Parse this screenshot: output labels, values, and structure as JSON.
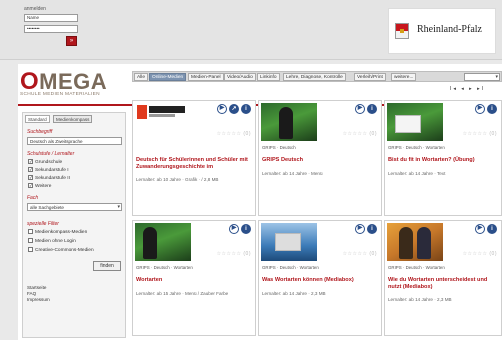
{
  "login": {
    "title": "anmelden",
    "username": "Name",
    "password": "••••••••",
    "submit": "»"
  },
  "brand": {
    "partner": "Rheinland-Pfalz",
    "logo_main": "MEGA",
    "logo_first": "O",
    "logo_sub": "SCHULE MEDIEN MATERIALIEN"
  },
  "tabs": [
    {
      "label": "Alle",
      "active": false
    },
    {
      "label": "Online-Medien",
      "active": true
    },
    {
      "label": "Medien-Panel",
      "active": false
    },
    {
      "label": "Video/Audio",
      "active": false
    },
    {
      "label": "Linkinfo",
      "active": false
    },
    {
      "label": "Lehre, Diagnose, Kontrolle",
      "active": false
    },
    {
      "label": "Verleih/Print",
      "active": false
    }
  ],
  "tab_more": "weitere...",
  "pager": "I◂ ◂ ▸ ▸I",
  "sidebar": {
    "tabs": [
      "Standard",
      "Medienkompass"
    ],
    "search_label": "Suchbegriff",
    "search_value": "Deutsch als Zweitsprache",
    "schools_label": "Schulstufe / Lernalter",
    "schools": [
      {
        "label": "Grundschule",
        "checked": true
      },
      {
        "label": "Sekundarstufe I",
        "checked": true
      },
      {
        "label": "Sekundarstufe II",
        "checked": true
      },
      {
        "label": "Weitere",
        "checked": true
      }
    ],
    "subject_label": "Fach",
    "subject_value": "alle Sachgebiete",
    "filter_label": "spezielle Filter",
    "filters": [
      {
        "label": "Medienkompass-Medien",
        "checked": false
      },
      {
        "label": "Medien ohne Login",
        "checked": false
      },
      {
        "label": "Creative-Commons-Medien",
        "checked": false
      }
    ],
    "find_button": "finden",
    "footer_links": [
      "Startseite",
      "FAQ",
      "Impressum"
    ]
  },
  "cards": [
    {
      "thumb": "white",
      "meta": "",
      "title": "Deutsch für Schülerinnen und Schüler mit Zuwanderungsgeschichte im",
      "info": "Lernalter: ab 10 Jahre · Grafik · / 2,8 MB"
    },
    {
      "thumb": "green",
      "meta": "GRIPS · Deutsch",
      "title": "GRIPS Deutsch",
      "info": "Lernalter: ab 14 Jahre · Menü"
    },
    {
      "thumb": "green",
      "meta": "GRIPS · Deutsch · Wortarten",
      "title": "Bist du fit in Wortarten? (Übung)",
      "info": "Lernalter: ab 14 Jahre · Text"
    },
    {
      "thumb": "green",
      "meta": "GRIPS · Deutsch · Wortarten",
      "title": "Wortarten",
      "info": "Lernalter: ab 15 Jahre · Menü / Zauber Farbe"
    },
    {
      "thumb": "blue",
      "meta": "GRIPS · Deutsch · Wortarten",
      "title": "Was Wortarten können (Mediabox)",
      "info": "Lernalter: ab 14 Jahre · 2,3 MB"
    },
    {
      "thumb": "orange",
      "meta": "GRIPS · Deutsch · Wortarten",
      "title": "Wie du Wortarten unterscheidest und nutzt (Mediabox)",
      "info": "Lernalter: ab 14 Jahre · 2,3 MB"
    }
  ],
  "rating_stars": "☆☆☆☆☆ (0)",
  "colors": {
    "accent": "#b0161c",
    "tab_active": "#7c93b0",
    "icon_blue": "#2b4f8a"
  }
}
